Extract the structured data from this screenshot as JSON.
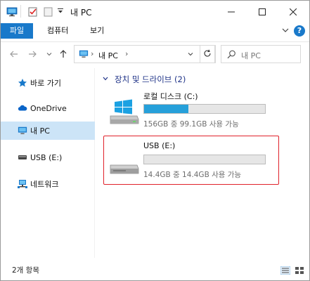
{
  "window": {
    "title": "내 PC"
  },
  "ribbon": {
    "tabs": [
      {
        "label": "파일",
        "active": true
      },
      {
        "label": "컴퓨터",
        "active": false
      },
      {
        "label": "보기",
        "active": false
      }
    ],
    "help": "?"
  },
  "address": {
    "path": "내 PC",
    "separator": "›"
  },
  "search": {
    "placeholder": "내 PC"
  },
  "sidebar": {
    "items": [
      {
        "label": "바로 가기",
        "icon": "star-icon",
        "selected": false
      },
      {
        "label": "OneDrive",
        "icon": "cloud-icon",
        "selected": false
      },
      {
        "label": "내 PC",
        "icon": "computer-icon",
        "selected": true
      },
      {
        "label": "USB (E:)",
        "icon": "drive-icon",
        "selected": false
      },
      {
        "label": "네트워크",
        "icon": "network-icon",
        "selected": false
      }
    ]
  },
  "content": {
    "group_header": "장치 및 드라이브 (2)",
    "drives": [
      {
        "name": "로컬 디스크 (C:)",
        "info": "156GB 중 99.1GB 사용 가능",
        "used_fraction": 0.365,
        "has_windows_logo": true
      },
      {
        "name": "USB (E:)",
        "info": "14.4GB 중 14.4GB 사용 가능",
        "used_fraction": 0.0,
        "has_windows_logo": false
      }
    ]
  },
  "status": {
    "item_count": "2개 항목"
  },
  "colors": {
    "accent": "#1979ca",
    "bar_fill": "#26a0da",
    "highlight": "#e0212a",
    "selected": "#cce4f7"
  }
}
